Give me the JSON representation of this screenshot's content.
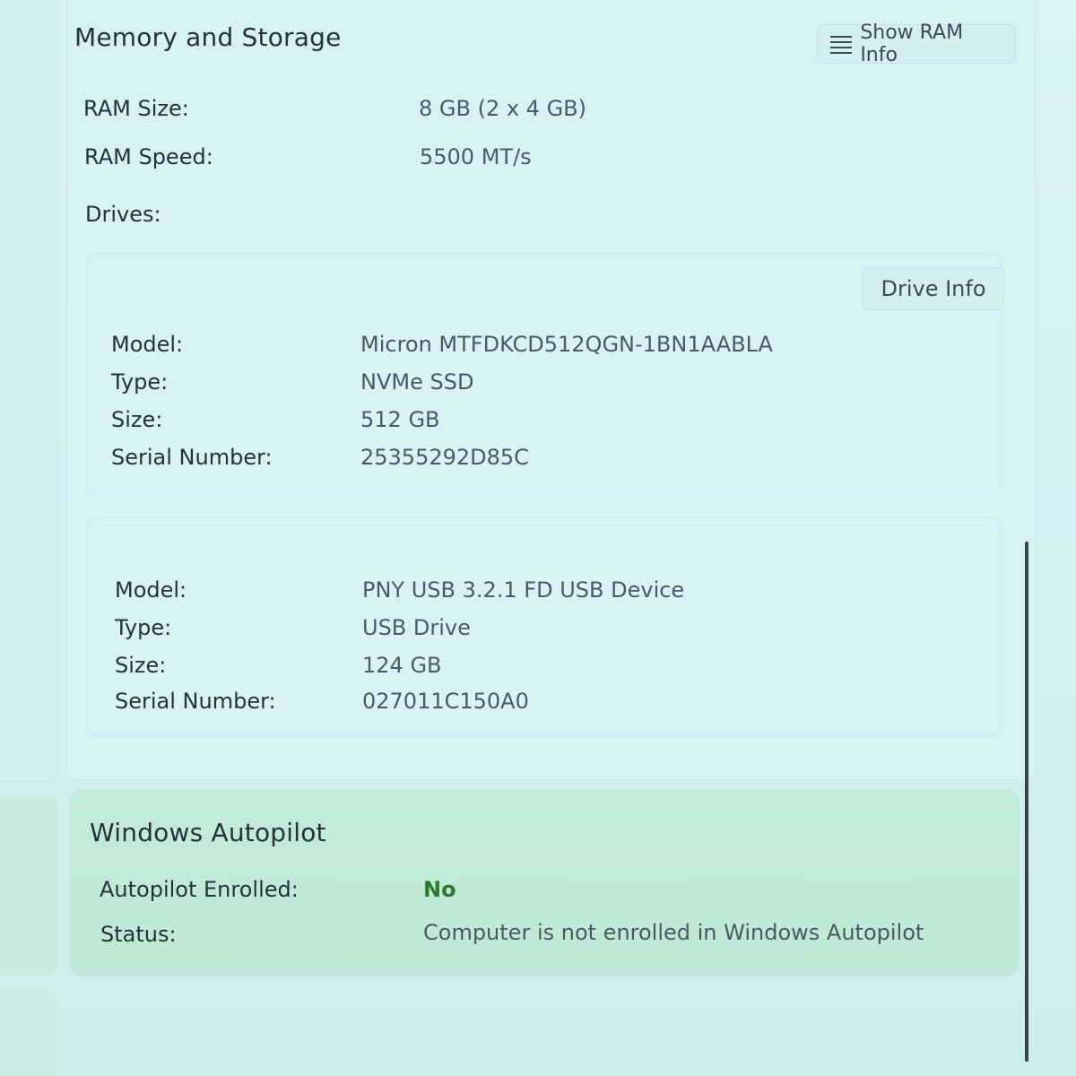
{
  "memory_storage": {
    "title": "Memory and Storage",
    "show_ram_button": "Show RAM Info",
    "ram_size_label": "RAM Size:",
    "ram_size_value": "8 GB (2 x 4 GB)",
    "ram_speed_label": "RAM Speed:",
    "ram_speed_value": "5500 MT/s",
    "drives_label": "Drives:",
    "drive_info_button": "Drive Info",
    "drives": [
      {
        "model_label": "Model:",
        "model": "Micron MTFDKCD512QGN-1BN1AABLA",
        "type_label": "Type:",
        "type": "NVMe SSD",
        "size_label": "Size:",
        "size": "512 GB",
        "serial_label": "Serial Number:",
        "serial": "25355292D85C"
      },
      {
        "model_label": "Model:",
        "model": "PNY USB 3.2.1 FD USB Device",
        "type_label": "Type:",
        "type": "USB Drive",
        "size_label": "Size:",
        "size": "124 GB",
        "serial_label": "Serial Number:",
        "serial": "027011C150A0"
      }
    ]
  },
  "autopilot": {
    "title": "Windows Autopilot",
    "enrolled_label": "Autopilot Enrolled:",
    "enrolled_value": "No",
    "enrolled_color": "#2b7a2e",
    "status_label": "Status:",
    "status_value": "Computer is not enrolled in Windows Autopilot"
  },
  "icons": {
    "show_ram_icon": "list-icon"
  }
}
